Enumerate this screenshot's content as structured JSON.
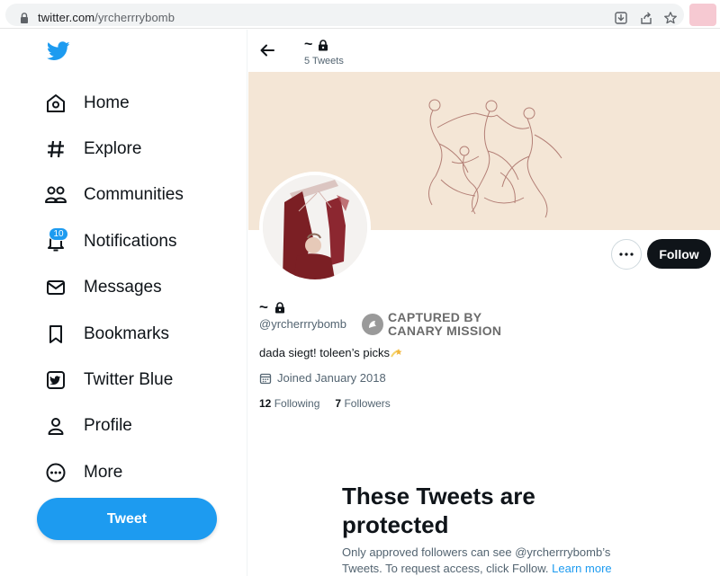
{
  "browser": {
    "url_domain": "twitter.com",
    "url_path": "/yrcherrrybomb"
  },
  "sidebar": {
    "items": [
      {
        "label": "Home",
        "icon": "home-icon"
      },
      {
        "label": "Explore",
        "icon": "hashtag-icon"
      },
      {
        "label": "Communities",
        "icon": "communities-icon"
      },
      {
        "label": "Notifications",
        "icon": "bell-icon",
        "badge": "10"
      },
      {
        "label": "Messages",
        "icon": "envelope-icon"
      },
      {
        "label": "Bookmarks",
        "icon": "bookmark-icon"
      },
      {
        "label": "Twitter Blue",
        "icon": "twitter-blue-icon"
      },
      {
        "label": "Profile",
        "icon": "person-icon"
      },
      {
        "label": "More",
        "icon": "more-circle-icon"
      }
    ],
    "tweet_button": "Tweet"
  },
  "header": {
    "name": "~",
    "tweet_count": "5 Tweets"
  },
  "profile": {
    "display_name": "~",
    "handle": "@yrcherrrybomb",
    "bio": "dada siegt! toleen’s picks",
    "joined": "Joined January 2018",
    "following_count": "12",
    "following_label": "Following",
    "followers_count": "7",
    "followers_label": "Followers",
    "follow_button": "Follow"
  },
  "stamp": {
    "line1": "CAPTURED BY",
    "line2": "CANARY MISSION"
  },
  "protected": {
    "title": "These Tweets are protected",
    "text": "Only approved followers can see @yrcherrrybomb’s Tweets. To request access, click Follow.",
    "link": "Learn more"
  },
  "colors": {
    "accent": "#1d9bf0",
    "banner": "#f4e6d6",
    "text": "#0f1419",
    "muted": "#536471"
  }
}
